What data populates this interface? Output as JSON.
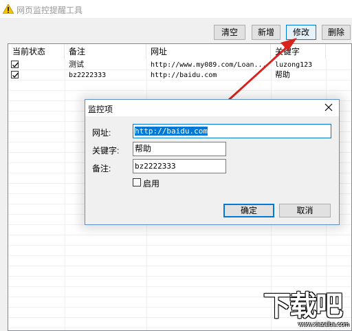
{
  "window": {
    "title": "网页监控提醒工具"
  },
  "toolbar": {
    "clear": "清空",
    "add": "新增",
    "edit": "修改",
    "delete": "删除"
  },
  "list": {
    "columns": [
      "当前状态",
      "备注",
      "网址",
      "关键字"
    ],
    "rows": [
      {
        "checked": true,
        "note": "测试",
        "url": "http://www.my089.com/Loan...",
        "keyword": "luzong123"
      },
      {
        "checked": true,
        "note": "bz2222333",
        "url": "http://baidu.com",
        "keyword": "帮助"
      }
    ]
  },
  "dialog": {
    "title": "监控项",
    "url_label": "网址:",
    "url_value": "http://baidu.com",
    "keyword_label": "关键字:",
    "keyword_value": "帮助",
    "note_label": "备注:",
    "note_value": "bz2222333",
    "enable_label": "启用",
    "enable_checked": false,
    "ok": "确定",
    "cancel": "取消"
  },
  "watermark": {
    "text": "下载吧",
    "url": "www.xiazaiba.com"
  },
  "colors": {
    "accent": "#0078d7",
    "arrow": "#d9231f"
  }
}
